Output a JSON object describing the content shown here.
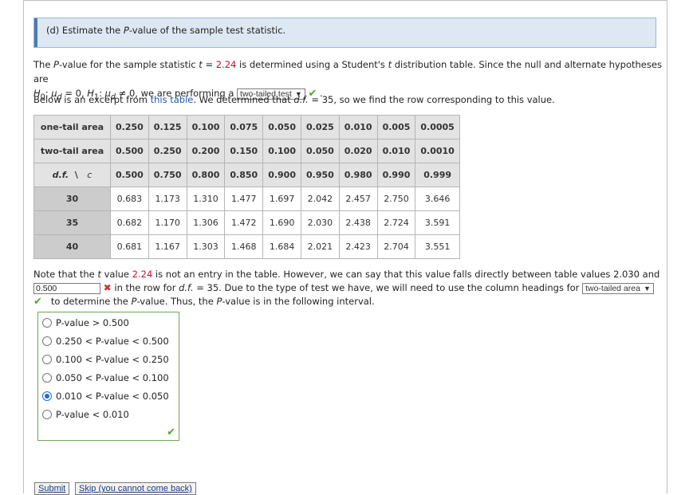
{
  "header": {
    "title_prefix": "(d)  Estimate the ",
    "title_var": "P",
    "title_suffix": "-value of the sample test statistic."
  },
  "para1": {
    "a": "The ",
    "a_var": "P",
    "b": "-value for the sample statistic ",
    "t_var": "t",
    "c": " = ",
    "t_value": "2.24",
    "d": " is determined using a Student's ",
    "t2_var": "t",
    "e": " distribution table. Since the null and alternate hypotheses are",
    "h0": "H",
    "h0_sub": "0",
    "mu_d": "μ",
    "mu_sub": "d",
    "f": ": ",
    "g": " = 0, ",
    "h1": "H",
    "h1_sub": "1",
    "i": ": ",
    "j": " ≠ 0, we are performing a",
    "test_select": "two-tailed test",
    "k": "."
  },
  "para2": {
    "a": "Below is an excerpt from ",
    "link": "this table",
    "b": ". We determined that ",
    "df": "d.f.",
    "c": " = 35, so we find the row corresponding to this value."
  },
  "table": {
    "one_tail_label": "one-tail area",
    "two_tail_label": "two-tail area",
    "df_label": "d.f.",
    "slash": "\\",
    "c_label": "c",
    "one_tail": [
      "0.250",
      "0.125",
      "0.100",
      "0.075",
      "0.050",
      "0.025",
      "0.010",
      "0.005",
      "0.0005"
    ],
    "two_tail": [
      "0.500",
      "0.250",
      "0.200",
      "0.150",
      "0.100",
      "0.050",
      "0.020",
      "0.010",
      "0.0010"
    ],
    "conf": [
      "0.500",
      "0.750",
      "0.800",
      "0.850",
      "0.900",
      "0.950",
      "0.980",
      "0.990",
      "0.999"
    ],
    "rows": [
      {
        "df": "30",
        "vals": [
          "0.683",
          "1.173",
          "1.310",
          "1.477",
          "1.697",
          "2.042",
          "2.457",
          "2.750",
          "3.646"
        ]
      },
      {
        "df": "35",
        "vals": [
          "0.682",
          "1.170",
          "1.306",
          "1.472",
          "1.690",
          "2.030",
          "2.438",
          "2.724",
          "3.591"
        ]
      },
      {
        "df": "40",
        "vals": [
          "0.681",
          "1.167",
          "1.303",
          "1.468",
          "1.684",
          "2.021",
          "2.423",
          "2.704",
          "3.551"
        ]
      }
    ]
  },
  "para3": {
    "a": "Note that the ",
    "t_var": "t",
    "b": " value ",
    "t_value": "2.24",
    "c": " is not an entry in the table. However, we can say that this value falls directly between table values 2.030 and",
    "input_value": "0.500",
    "d": " in the row for ",
    "df": "d.f.",
    "e": " = 35. Due to the type of test we have, we will need to use the column headings for",
    "area_select": "two-tailed area",
    "f": " to determine the ",
    "p_var": "P",
    "g": "-value. Thus, the ",
    "p2_var": "P",
    "h": "-value is in the following interval."
  },
  "options": [
    {
      "label": "P-value > 0.500",
      "selected": false
    },
    {
      "label": "0.250 < P-value < 0.500",
      "selected": false
    },
    {
      "label": "0.100 < P-value < 0.250",
      "selected": false
    },
    {
      "label": "0.050 < P-value < 0.100",
      "selected": false
    },
    {
      "label": "0.010 < P-value < 0.050",
      "selected": true
    },
    {
      "label": "P-value < 0.010",
      "selected": false
    }
  ],
  "buttons": {
    "submit": "Submit",
    "skip": "Skip (you cannot come back)"
  },
  "colors": {
    "accent": "#4b79b4",
    "correct": "#4ea72e",
    "wrong": "#d0312d",
    "highlight": "#c8102e"
  }
}
